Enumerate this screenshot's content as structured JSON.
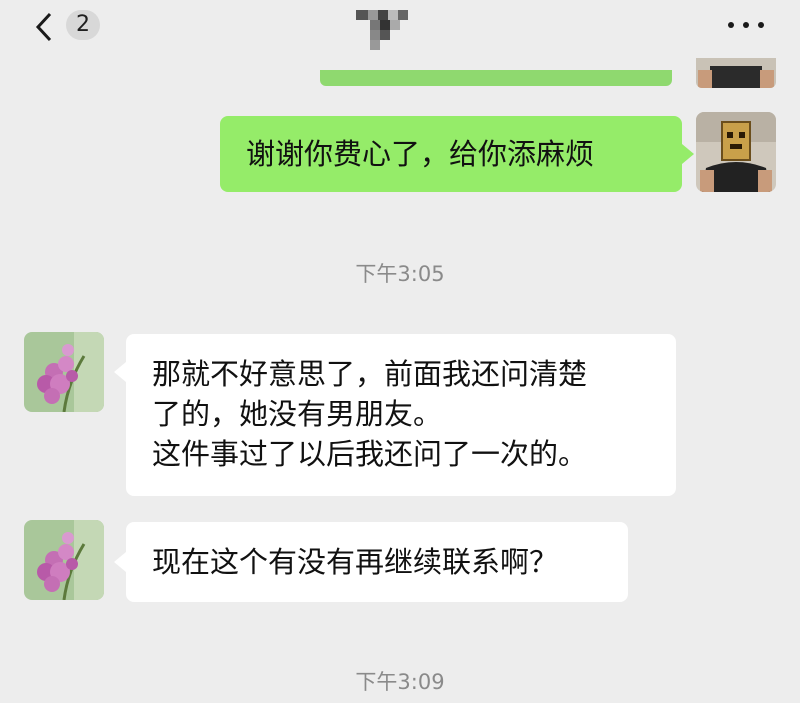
{
  "header": {
    "unread_count": "2",
    "back_icon": "chevron-left-icon",
    "more_icon": "more-dots-icon"
  },
  "messages": [
    {
      "side": "right",
      "text": "谢谢你费心了，给你添麻烦"
    },
    {
      "timestamp": "下午3:05"
    },
    {
      "side": "left",
      "lines": [
        "那就不好意思了，前面我还问清楚",
        "了的，她没有男朋友。",
        "这件事过了以后我还问了一次的。"
      ]
    },
    {
      "side": "left",
      "text": "现在这个有没有再继续联系啊？"
    },
    {
      "timestamp": "下午3:09"
    }
  ],
  "colors": {
    "background": "#ededed",
    "sent_bubble": "#95ec69",
    "received_bubble": "#ffffff",
    "timestamp_text": "#8a8a8a"
  }
}
